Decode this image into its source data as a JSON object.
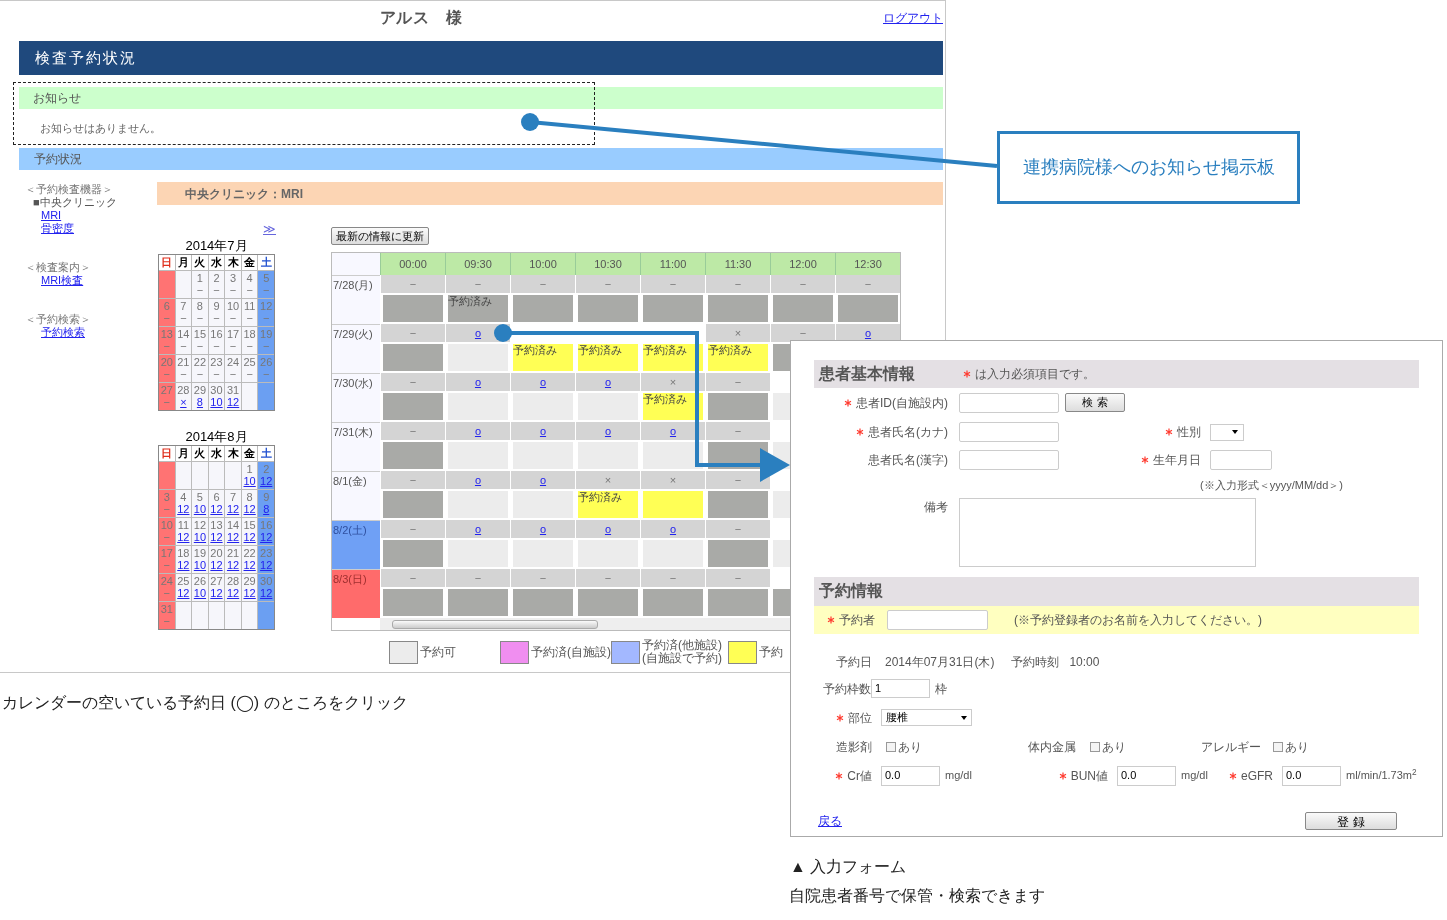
{
  "header": {
    "user": "アルス　様",
    "logout": "ログアウト",
    "title": "検査予約状況"
  },
  "notice": {
    "title": "お知らせ",
    "text": "お知らせはありません。"
  },
  "status_title": "予約状況",
  "sidebar": [
    {
      "heading": "＜予約検査機器＞",
      "subheading": "■中央クリニック",
      "links": [
        "MRI",
        "骨密度"
      ]
    },
    {
      "heading": "＜検査案内＞",
      "links": [
        "MRI検査"
      ]
    },
    {
      "heading": "＜予約検索＞",
      "links": [
        "予約検索"
      ]
    }
  ],
  "device_title": "中央クリニック：MRI",
  "next_link": "≫",
  "calendars": [
    {
      "title": "2014年7月",
      "weekdays": [
        {
          "label": "日",
          "kind": "sunday"
        },
        {
          "label": "月",
          "kind": "weekday"
        },
        {
          "label": "火",
          "kind": "weekday"
        },
        {
          "label": "水",
          "kind": "weekday"
        },
        {
          "label": "木",
          "kind": "weekday"
        },
        {
          "label": "金",
          "kind": "weekday"
        },
        {
          "label": "土",
          "kind": "saturday"
        }
      ],
      "weeks": [
        [
          {
            "kind": "blank"
          },
          {
            "kind": "blank"
          },
          {
            "kind": "day",
            "day": "1",
            "mark": "−",
            "link": false
          },
          {
            "kind": "day",
            "day": "2",
            "mark": "−",
            "link": false
          },
          {
            "kind": "day",
            "day": "3",
            "mark": "−",
            "link": false
          },
          {
            "kind": "day",
            "day": "4",
            "mark": "−",
            "link": false
          },
          {
            "kind": "day",
            "day": "5",
            "mark": "−",
            "link": false
          }
        ],
        [
          {
            "kind": "day",
            "day": "6",
            "mark": "−",
            "link": false
          },
          {
            "kind": "day",
            "day": "7",
            "mark": "−",
            "link": false
          },
          {
            "kind": "day",
            "day": "8",
            "mark": "−",
            "link": false
          },
          {
            "kind": "day",
            "day": "9",
            "mark": "−",
            "link": false
          },
          {
            "kind": "day",
            "day": "10",
            "mark": "−",
            "link": false
          },
          {
            "kind": "day",
            "day": "11",
            "mark": "−",
            "link": false
          },
          {
            "kind": "day",
            "day": "12",
            "mark": "−",
            "link": false
          }
        ],
        [
          {
            "kind": "day",
            "day": "13",
            "mark": "−",
            "link": false
          },
          {
            "kind": "day",
            "day": "14",
            "mark": "−",
            "link": false
          },
          {
            "kind": "day",
            "day": "15",
            "mark": "−",
            "link": false
          },
          {
            "kind": "day",
            "day": "16",
            "mark": "−",
            "link": false
          },
          {
            "kind": "day",
            "day": "17",
            "mark": "−",
            "link": false
          },
          {
            "kind": "day",
            "day": "18",
            "mark": "−",
            "link": false
          },
          {
            "kind": "day",
            "day": "19",
            "mark": "−",
            "link": false
          }
        ],
        [
          {
            "kind": "day",
            "day": "20",
            "mark": "−",
            "link": false
          },
          {
            "kind": "day",
            "day": "21",
            "mark": "−",
            "link": false
          },
          {
            "kind": "day",
            "day": "22",
            "mark": "−",
            "link": false
          },
          {
            "kind": "day",
            "day": "23",
            "mark": "−",
            "link": false
          },
          {
            "kind": "day",
            "day": "24",
            "mark": "−",
            "link": false
          },
          {
            "kind": "day",
            "day": "25",
            "mark": "−",
            "link": false
          },
          {
            "kind": "day",
            "day": "26",
            "mark": "−",
            "link": false
          }
        ],
        [
          {
            "kind": "day",
            "day": "27",
            "mark": "−",
            "link": false
          },
          {
            "kind": "day",
            "day": "28",
            "mark": "×",
            "link": true
          },
          {
            "kind": "day",
            "day": "29",
            "mark": "8",
            "link": true
          },
          {
            "kind": "day",
            "day": "30",
            "mark": "10",
            "link": true
          },
          {
            "kind": "day",
            "day": "31",
            "mark": "12",
            "link": true
          },
          {
            "kind": "blank"
          },
          {
            "kind": "blank"
          }
        ]
      ]
    },
    {
      "title": "2014年8月",
      "weekdays": [
        {
          "label": "日",
          "kind": "sunday"
        },
        {
          "label": "月",
          "kind": "weekday"
        },
        {
          "label": "火",
          "kind": "weekday"
        },
        {
          "label": "水",
          "kind": "weekday"
        },
        {
          "label": "木",
          "kind": "weekday"
        },
        {
          "label": "金",
          "kind": "weekday"
        },
        {
          "label": "土",
          "kind": "saturday"
        }
      ],
      "weeks": [
        [
          {
            "kind": "blank"
          },
          {
            "kind": "blank"
          },
          {
            "kind": "blank"
          },
          {
            "kind": "blank"
          },
          {
            "kind": "blank"
          },
          {
            "kind": "day",
            "day": "1",
            "mark": "10",
            "link": true
          },
          {
            "kind": "day",
            "day": "2",
            "mark": "12",
            "link": true
          }
        ],
        [
          {
            "kind": "day",
            "day": "3",
            "mark": "−",
            "link": false
          },
          {
            "kind": "day",
            "day": "4",
            "mark": "12",
            "link": true
          },
          {
            "kind": "day",
            "day": "5",
            "mark": "10",
            "link": true
          },
          {
            "kind": "day",
            "day": "6",
            "mark": "12",
            "link": true
          },
          {
            "kind": "day",
            "day": "7",
            "mark": "12",
            "link": true
          },
          {
            "kind": "day",
            "day": "8",
            "mark": "12",
            "link": true
          },
          {
            "kind": "day",
            "day": "9",
            "mark": "8",
            "link": true
          }
        ],
        [
          {
            "kind": "day",
            "day": "10",
            "mark": "−",
            "link": false
          },
          {
            "kind": "day",
            "day": "11",
            "mark": "12",
            "link": true
          },
          {
            "kind": "day",
            "day": "12",
            "mark": "10",
            "link": true
          },
          {
            "kind": "day",
            "day": "13",
            "mark": "12",
            "link": true
          },
          {
            "kind": "day",
            "day": "14",
            "mark": "12",
            "link": true
          },
          {
            "kind": "day",
            "day": "15",
            "mark": "12",
            "link": true
          },
          {
            "kind": "day",
            "day": "16",
            "mark": "12",
            "link": true
          }
        ],
        [
          {
            "kind": "day",
            "day": "17",
            "mark": "−",
            "link": false
          },
          {
            "kind": "day",
            "day": "18",
            "mark": "12",
            "link": true
          },
          {
            "kind": "day",
            "day": "19",
            "mark": "10",
            "link": true
          },
          {
            "kind": "day",
            "day": "20",
            "mark": "12",
            "link": true
          },
          {
            "kind": "day",
            "day": "21",
            "mark": "12",
            "link": true
          },
          {
            "kind": "day",
            "day": "22",
            "mark": "12",
            "link": true
          },
          {
            "kind": "day",
            "day": "23",
            "mark": "12",
            "link": true
          }
        ],
        [
          {
            "kind": "day",
            "day": "24",
            "mark": "−",
            "link": false
          },
          {
            "kind": "day",
            "day": "25",
            "mark": "12",
            "link": true
          },
          {
            "kind": "day",
            "day": "26",
            "mark": "10",
            "link": true
          },
          {
            "kind": "day",
            "day": "27",
            "mark": "12",
            "link": true
          },
          {
            "kind": "day",
            "day": "28",
            "mark": "12",
            "link": true
          },
          {
            "kind": "day",
            "day": "29",
            "mark": "12",
            "link": true
          },
          {
            "kind": "day",
            "day": "30",
            "mark": "12",
            "link": true
          }
        ],
        [
          {
            "kind": "day",
            "day": "31",
            "mark": "−",
            "link": false
          },
          {
            "kind": "blank"
          },
          {
            "kind": "blank"
          },
          {
            "kind": "blank"
          },
          {
            "kind": "blank"
          },
          {
            "kind": "blank"
          },
          {
            "kind": "blank"
          }
        ]
      ]
    }
  ],
  "refresh_button": "最新の情報に更新",
  "schedule": {
    "times": [
      "00:00",
      "09:30",
      "10:00",
      "10:30",
      "11:00",
      "11:30",
      "12:00",
      "12:30"
    ],
    "rows": [
      {
        "date": "7/28(月)",
        "kind": "weekday",
        "slots": [
          {
            "mark": "−",
            "link": false,
            "kind": "closed"
          },
          {
            "mark": "−",
            "link": false,
            "kind": "closed",
            "label": "予約済み"
          },
          {
            "mark": "−",
            "link": false,
            "kind": "closed"
          },
          {
            "mark": "−",
            "link": false,
            "kind": "closed"
          },
          {
            "mark": "−",
            "link": false,
            "kind": "closed"
          },
          {
            "mark": "−",
            "link": false,
            "kind": "closed"
          },
          {
            "mark": "−",
            "link": false,
            "kind": "closed"
          },
          {
            "mark": "−",
            "link": false,
            "kind": "closed"
          }
        ]
      },
      {
        "date": "7/29(火)",
        "kind": "weekday",
        "slots": [
          {
            "mark": "−",
            "link": false,
            "kind": "closed"
          },
          {
            "mark": "o",
            "link": true,
            "kind": "open"
          },
          {
            "kind": "booked",
            "label": "予約済み"
          },
          {
            "kind": "booked",
            "label": "予約済み"
          },
          {
            "kind": "booked",
            "label": "予約済み"
          },
          {
            "mark": "×",
            "link": false,
            "kind": "booked",
            "label": "予約済み"
          },
          {
            "mark": "−",
            "link": false,
            "kind": "closed"
          },
          {
            "mark": "o",
            "link": true
          }
        ]
      },
      {
        "date": "7/30(水)",
        "kind": "weekday",
        "slots": [
          {
            "mark": "−",
            "link": false,
            "kind": "closed"
          },
          {
            "mark": "o",
            "link": true,
            "kind": "open"
          },
          {
            "mark": "o",
            "link": true,
            "kind": "open"
          },
          {
            "mark": "o",
            "link": true,
            "kind": "open"
          },
          {
            "mark": "×",
            "link": false,
            "kind": "booked",
            "label": "予約済み"
          },
          {
            "mark": "−",
            "link": false,
            "kind": "closed"
          },
          {
            "kind": "open"
          }
        ]
      },
      {
        "date": "7/31(木)",
        "kind": "weekday",
        "slots": [
          {
            "mark": "−",
            "link": false,
            "kind": "closed"
          },
          {
            "mark": "o",
            "link": true,
            "kind": "open"
          },
          {
            "mark": "o",
            "link": true,
            "kind": "open"
          },
          {
            "mark": "o",
            "link": true,
            "kind": "open"
          },
          {
            "mark": "o",
            "link": true,
            "kind": "open"
          },
          {
            "mark": "−",
            "link": false,
            "kind": "closed"
          },
          {
            "kind": "open"
          }
        ]
      },
      {
        "date": "8/1(金)",
        "kind": "weekday",
        "slots": [
          {
            "mark": "−",
            "link": false,
            "kind": "closed"
          },
          {
            "mark": "o",
            "link": true,
            "kind": "open"
          },
          {
            "mark": "o",
            "link": true,
            "kind": "open"
          },
          {
            "mark": "×",
            "link": false,
            "kind": "booked",
            "label": "予約済み"
          },
          {
            "mark": "×",
            "link": false,
            "kind": "booked"
          },
          {
            "mark": "−",
            "link": false,
            "kind": "closed"
          },
          {
            "kind": "open"
          }
        ]
      },
      {
        "date": "8/2(土)",
        "kind": "saturday",
        "slots": [
          {
            "mark": "−",
            "link": false,
            "kind": "closed"
          },
          {
            "mark": "o",
            "link": true,
            "kind": "open"
          },
          {
            "mark": "o",
            "link": true,
            "kind": "open"
          },
          {
            "mark": "o",
            "link": true,
            "kind": "open"
          },
          {
            "mark": "o",
            "link": true,
            "kind": "open"
          },
          {
            "mark": "−",
            "link": false,
            "kind": "closed"
          },
          {
            "kind": "open"
          }
        ]
      },
      {
        "date": "8/3(日)",
        "kind": "sunday",
        "slots": [
          {
            "mark": "−",
            "link": false,
            "kind": "closed"
          },
          {
            "mark": "−",
            "link": false,
            "kind": "closed"
          },
          {
            "mark": "−",
            "link": false,
            "kind": "closed"
          },
          {
            "mark": "−",
            "link": false,
            "kind": "closed"
          },
          {
            "mark": "−",
            "link": false,
            "kind": "closed"
          },
          {
            "mark": "−",
            "link": false,
            "kind": "closed"
          },
          {
            "kind": "closed"
          }
        ]
      }
    ]
  },
  "legend": [
    {
      "label": "予約可",
      "color": "#ececec"
    },
    {
      "label": "予約済(自施設)",
      "color": "#f08ef0"
    },
    {
      "label": "予約済(他施設)\n(自施設で予約)",
      "color": "#a3b8ff"
    },
    {
      "label": "予約",
      "color": "#ffff55"
    }
  ],
  "callout": "連携病院様へのお知らせ掲示板",
  "caption_left": "カレンダーの空いている予約日 (◯) のところをクリック",
  "form": {
    "patient": {
      "title": "患者基本情報",
      "note": "は入力必須項目です。",
      "id_field": {
        "label": "患者ID(自施設内)",
        "required": true
      },
      "search_button": "検 索",
      "kana_field": {
        "label": "患者氏名(カナ)",
        "required": true
      },
      "sex_field": {
        "label": "性別",
        "required": true
      },
      "kanji_field": {
        "label": "患者氏名(漢字)",
        "required": false
      },
      "birth_field": {
        "label": "生年月日",
        "required": true
      },
      "birth_hint": "(※入力形式＜yyyy/MM/dd＞)",
      "remarks_field": {
        "label": "備考"
      }
    },
    "reservation": {
      "title": "予約情報",
      "booker": {
        "label": "予約者",
        "required": true,
        "hint": "(※予約登録者のお名前を入力してください。)"
      },
      "date": {
        "label": "予約日",
        "value": "2014年07月31日(木)"
      },
      "time": {
        "label": "予約時刻",
        "value": "10:00"
      },
      "slots": {
        "label": "予約枠数",
        "value": "1",
        "unit": "枠"
      },
      "site": {
        "label": "部位",
        "required": true,
        "value": "腰椎"
      },
      "checks": [
        {
          "label": "造影剤",
          "option": "あり",
          "checked": false
        },
        {
          "label": "体内金属",
          "option": "あり",
          "checked": false
        },
        {
          "label": "アレルギー",
          "option": "あり",
          "checked": false
        }
      ],
      "values": [
        {
          "label": "Cr値",
          "required": true,
          "value": "0.0",
          "unit": "mg/dl"
        },
        {
          "label": "BUN値",
          "required": true,
          "value": "0.0",
          "unit": "mg/dl"
        },
        {
          "label": "eGFR",
          "required": true,
          "value": "0.0",
          "unit": "ml/min/1.73m$^{2}$"
        }
      ]
    },
    "back_link": "戻る",
    "submit_button": "登 録"
  },
  "caption_form": "▲ 入力フォーム",
  "caption_form_note": "自院患者番号で保管・検索できます"
}
